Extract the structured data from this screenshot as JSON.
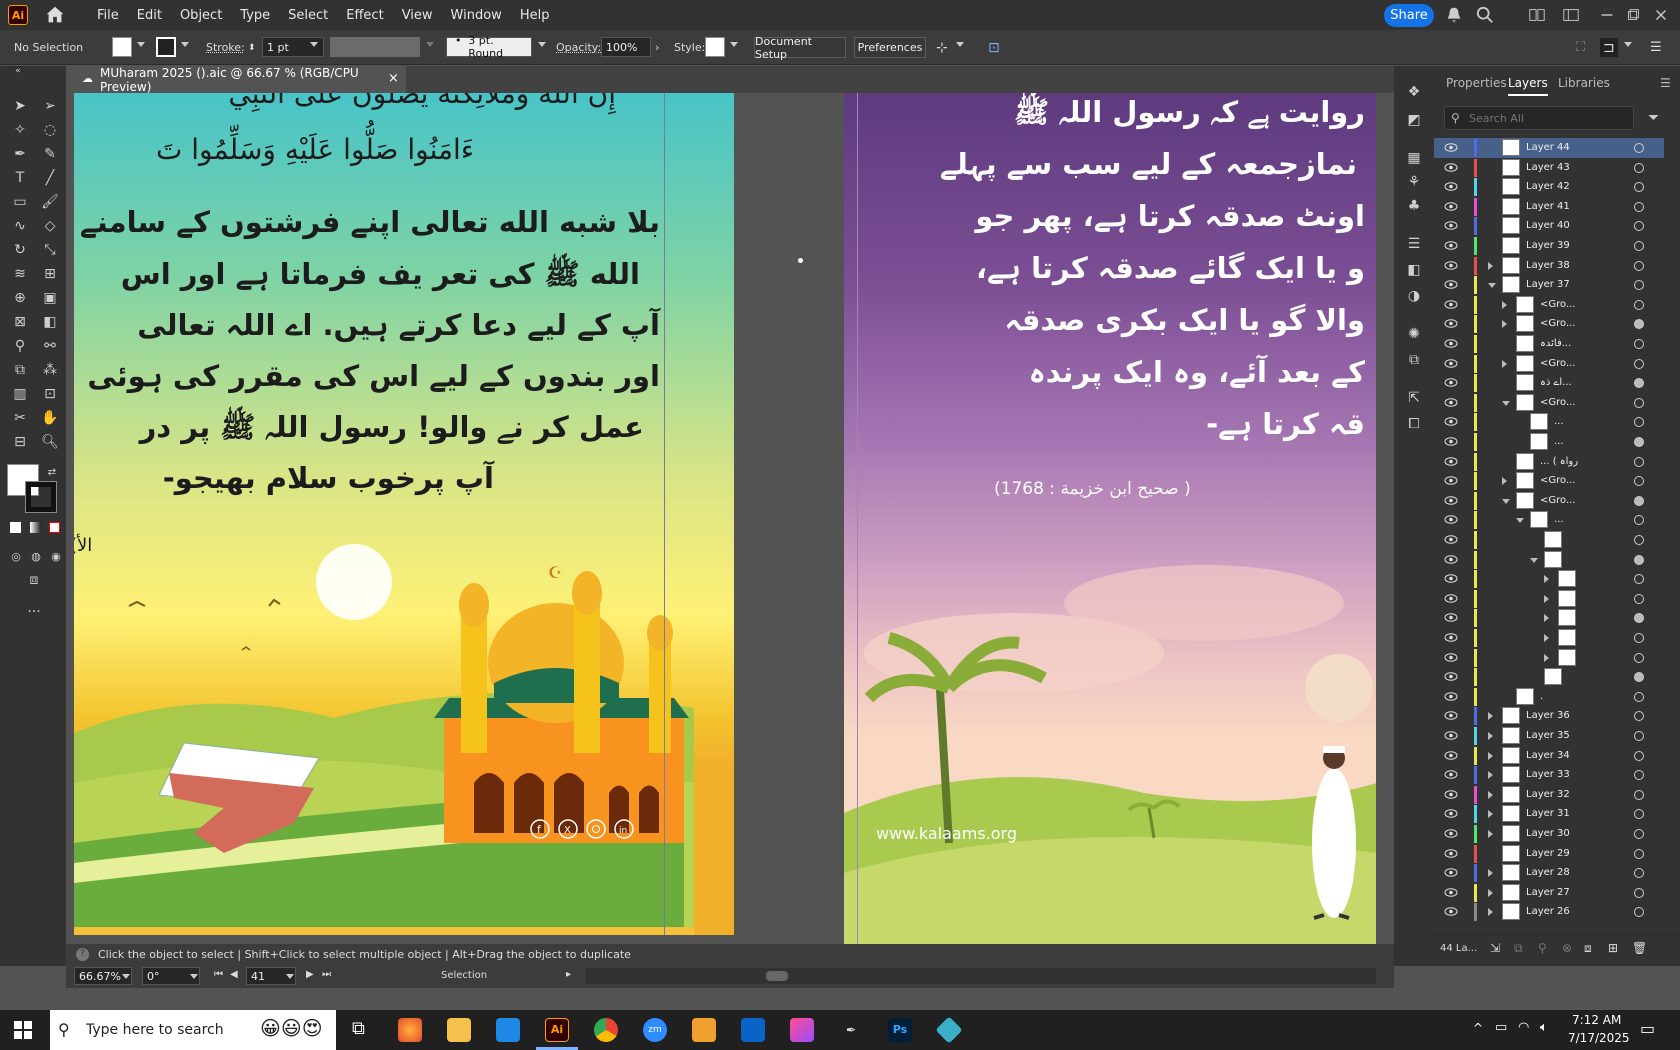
{
  "app": {
    "logo": "Ai",
    "menus": [
      "File",
      "Edit",
      "Object",
      "Type",
      "Select",
      "Effect",
      "View",
      "Window",
      "Help"
    ],
    "share_label": "Share"
  },
  "control_bar": {
    "selection": "No Selection",
    "stroke_label": "Stroke:",
    "stroke_value": "1 pt",
    "brush": "3 pt. Round",
    "opacity_label": "Opacity:",
    "opacity_value": "100%",
    "style_label": "Style:",
    "document_setup": "Document Setup",
    "preferences": "Preferences"
  },
  "document_tab": {
    "title": "MUharam 2025 ().aic @ 66.67 % (RGB/CPU Preview)",
    "close": "×"
  },
  "artboard1": {
    "lines": [
      "إِنَّ اللَّهَ وَمَلَائِكَتَهُ يُصَلُّونَ عَلَى النَّبِيِّ",
      "ءَامَنُوا صَلُّوا عَلَيْهِ وَسَلِّمُوا تَ",
      "بلا شبه الله تعالی اپنے فرشتوں کے سامنے",
      "الله ﷺ کی تعر یف فرماتا ہے اور اس",
      "آپ کے لیے دعا کرتے ہیں. اے اللہ تعالی",
      "اور بندوں کے لیے اس کی مقرر کی ہوئی",
      "عمل کر نے والو! رسول اللہ ﷺ پر در",
      "آپ پرخوب سلام بھیجو-"
    ],
    "reference": "(الأ"
  },
  "artboard2": {
    "lines": [
      "روایت ہے کہ رسول اللہ ﷺ",
      "نمازجمعہ کے لیے سب سے پہلے",
      "اونٹ صدقہ کرتا ہے، پھر جو",
      "و یا ایک گائے صدقہ کرتا ہے،",
      "والا گو یا ایک بکری صدقہ",
      "کے بعد آئے، وہ ایک پرندہ",
      "قہ کرتا ہے-"
    ],
    "reference": "(صحيح ابن خزيمة : 1768 )",
    "website": "www.kalaams.org"
  },
  "panel": {
    "tabs": [
      "Properties",
      "Layers",
      "Libraries"
    ],
    "search_placeholder": "Search All",
    "layers": [
      {
        "name": "Layer 44",
        "color": "#4f6ce8",
        "indent": 0,
        "arrow": "",
        "sel": true
      },
      {
        "name": "Layer 43",
        "color": "#e84f4f",
        "indent": 0,
        "arrow": ""
      },
      {
        "name": "Layer 42",
        "color": "#4fd6e8",
        "indent": 0,
        "arrow": ""
      },
      {
        "name": "Layer 41",
        "color": "#e84fd4",
        "indent": 0,
        "arrow": ""
      },
      {
        "name": "Layer 40",
        "color": "#4f6ce8",
        "indent": 0,
        "arrow": ""
      },
      {
        "name": "Layer 39",
        "color": "#4fe86c",
        "indent": 0,
        "arrow": ""
      },
      {
        "name": "Layer 38",
        "color": "#e84f4f",
        "indent": 0,
        "arrow": "right"
      },
      {
        "name": "Layer 37",
        "color": "#e8e84f",
        "indent": 0,
        "arrow": "down"
      },
      {
        "name": "<Gro...",
        "color": "#e8e84f",
        "indent": 1,
        "arrow": "right"
      },
      {
        "name": "<Gro...",
        "color": "#e8e84f",
        "indent": 1,
        "arrow": "right"
      },
      {
        "name": "فائدہ...",
        "color": "#e8e84f",
        "indent": 1,
        "arrow": ""
      },
      {
        "name": "<Gro...",
        "color": "#e8e84f",
        "indent": 1,
        "arrow": "right"
      },
      {
        "name": "اے ذہ...",
        "color": "#e8e84f",
        "indent": 1,
        "arrow": ""
      },
      {
        "name": "<Gro...",
        "color": "#e8e84f",
        "indent": 1,
        "arrow": "down"
      },
      {
        "name": "...",
        "color": "#e8e84f",
        "indent": 2,
        "arrow": ""
      },
      {
        "name": "...",
        "color": "#e8e84f",
        "indent": 2,
        "arrow": ""
      },
      {
        "name": "... ( رواہ",
        "color": "#e8e84f",
        "indent": 1,
        "arrow": ""
      },
      {
        "name": "<Gro...",
        "color": "#e8e84f",
        "indent": 1,
        "arrow": "right"
      },
      {
        "name": "<Gro...",
        "color": "#e8e84f",
        "indent": 1,
        "arrow": "down"
      },
      {
        "name": "...",
        "color": "#e8e84f",
        "indent": 2,
        "arrow": "down"
      },
      {
        "name": "",
        "color": "#e8e84f",
        "indent": 3,
        "arrow": ""
      },
      {
        "name": "",
        "color": "#e8e84f",
        "indent": 3,
        "arrow": "down"
      },
      {
        "name": "",
        "color": "#e8e84f",
        "indent": 4,
        "arrow": "right"
      },
      {
        "name": "",
        "color": "#e8e84f",
        "indent": 4,
        "arrow": "right"
      },
      {
        "name": "",
        "color": "#e8e84f",
        "indent": 4,
        "arrow": "right"
      },
      {
        "name": "",
        "color": "#e8e84f",
        "indent": 4,
        "arrow": "right"
      },
      {
        "name": "",
        "color": "#e8e84f",
        "indent": 4,
        "arrow": "right"
      },
      {
        "name": "",
        "color": "#e8e84f",
        "indent": 3,
        "arrow": ""
      },
      {
        "name": ".",
        "color": "#e8e84f",
        "indent": 1,
        "arrow": ""
      },
      {
        "name": "Layer 36",
        "color": "#4f6ce8",
        "indent": 0,
        "arrow": "right"
      },
      {
        "name": "Layer 35",
        "color": "#4fd6e8",
        "indent": 0,
        "arrow": "right"
      },
      {
        "name": "Layer 34",
        "color": "#e8e84f",
        "indent": 0,
        "arrow": "right"
      },
      {
        "name": "Layer 33",
        "color": "#4f6ce8",
        "indent": 0,
        "arrow": "right"
      },
      {
        "name": "Layer 32",
        "color": "#e84fd4",
        "indent": 0,
        "arrow": "right"
      },
      {
        "name": "Layer 31",
        "color": "#4fd6e8",
        "indent": 0,
        "arrow": "right"
      },
      {
        "name": "Layer 30",
        "color": "#4fe86c",
        "indent": 0,
        "arrow": "right"
      },
      {
        "name": "Layer 29",
        "color": "#e84f4f",
        "indent": 0,
        "arrow": ""
      },
      {
        "name": "Layer 28",
        "color": "#4f6ce8",
        "indent": 0,
        "arrow": "right"
      },
      {
        "name": "Layer 27",
        "color": "#e8e84f",
        "indent": 0,
        "arrow": "right"
      },
      {
        "name": "Layer 26",
        "color": "#888888",
        "indent": 0,
        "arrow": "right"
      }
    ],
    "footer_count": "44 La..."
  },
  "status": {
    "hint": "Click the object to select  |  Shift+Click to select multiple object  |  Alt+Drag the object to duplicate",
    "zoom": "66.67%",
    "rotation": "0°",
    "artboard": "41",
    "tool": "Selection"
  },
  "taskbar": {
    "search_placeholder": "Type here to search",
    "time": "7:12 AM",
    "date": "7/17/2025"
  }
}
